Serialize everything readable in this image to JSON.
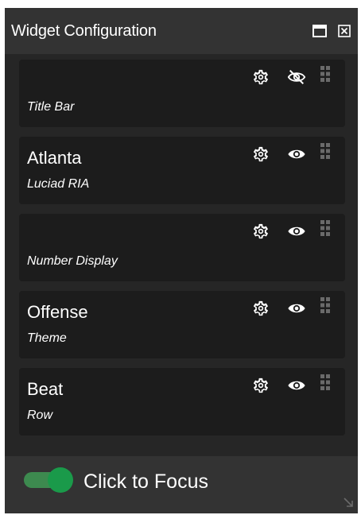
{
  "window": {
    "title": "Widget Configuration",
    "maximize_icon": "maximize-icon",
    "close_icon": "close-icon"
  },
  "widgets": [
    {
      "title": "",
      "subtitle": "Title Bar",
      "visible": false,
      "icons": [
        "gear-icon",
        "eye-slash-icon",
        "drag-handle-icon"
      ]
    },
    {
      "title": "Atlanta",
      "subtitle": "Luciad RIA",
      "visible": true,
      "icons": [
        "gear-icon",
        "eye-icon",
        "drag-handle-icon"
      ]
    },
    {
      "title": "",
      "subtitle": "Number Display",
      "visible": true,
      "icons": [
        "gear-icon",
        "eye-icon",
        "drag-handle-icon"
      ]
    },
    {
      "title": "Offense",
      "subtitle": "Theme",
      "visible": true,
      "icons": [
        "gear-icon",
        "eye-icon",
        "drag-handle-icon"
      ]
    },
    {
      "title": "Beat",
      "subtitle": "Row",
      "visible": true,
      "icons": [
        "gear-icon",
        "eye-icon",
        "drag-handle-icon"
      ]
    }
  ],
  "footer": {
    "toggle_on": true,
    "label": "Click to Focus"
  },
  "colors": {
    "panel_bg": "#2a2a2a",
    "titlebar_bg": "#333333",
    "card_bg": "#1c1c1c",
    "toggle_green": "#1a9a4a",
    "text": "#ffffff"
  }
}
